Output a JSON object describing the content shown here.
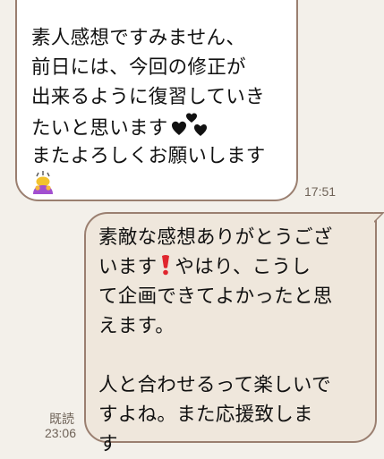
{
  "chat": {
    "incoming": {
      "lines": [
        "素人感想ですみません、",
        "前日には、今回の修正が",
        "出来るように復習していき",
        "たいと思います",
        "またよろしくお願いします"
      ],
      "time": "17:51"
    },
    "outgoing": {
      "lines": [
        "素敵な感想ありがとうござ",
        "います",
        "やはり、こうし",
        "て企画できてよかったと思",
        "えます。",
        "人と合わせるって楽しいで",
        "すよね。また応援致しま",
        "す"
      ],
      "read_label": "既読",
      "time": "23:06"
    },
    "icons": [
      "black-hearts-icon",
      "bowing-person-icon",
      "red-exclamation-icon"
    ]
  }
}
